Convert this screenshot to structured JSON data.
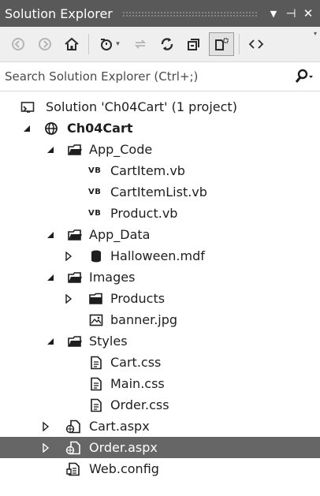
{
  "window": {
    "title": "Solution Explorer",
    "controls": {
      "dropdown": "▼",
      "pin": "⊣",
      "close": "✕"
    }
  },
  "toolbar": {
    "buttons": [
      "back-icon",
      "forward-icon",
      "home-icon",
      "pending-changes-icon",
      "sync-icon",
      "refresh-icon",
      "collapse-all-icon",
      "show-all-files-icon",
      "view-code-icon"
    ],
    "overflow": "▾"
  },
  "search": {
    "placeholder": "Search Solution Explorer (Ctrl+;)",
    "dropdown": "▾"
  },
  "tree": {
    "solution": "Solution 'Ch04Cart' (1 project)",
    "project": "Ch04Cart",
    "app_code": "App_Code",
    "cartitem_vb": "CartItem.vb",
    "cartitemlist_vb": "CartItemList.vb",
    "product_vb": "Product.vb",
    "app_data": "App_Data",
    "halloween_mdf": "Halloween.mdf",
    "images": "Images",
    "products": "Products",
    "banner_jpg": "banner.jpg",
    "styles": "Styles",
    "cart_css": "Cart.css",
    "main_css": "Main.css",
    "order_css": "Order.css",
    "cart_aspx": "Cart.aspx",
    "order_aspx": "Order.aspx",
    "web_config": "Web.config",
    "vb_badge": "VB",
    "selected_item": "Order.aspx"
  },
  "colors": {
    "titlebar": "#595959",
    "toolbar": "#efefef",
    "selection": "#666666"
  }
}
